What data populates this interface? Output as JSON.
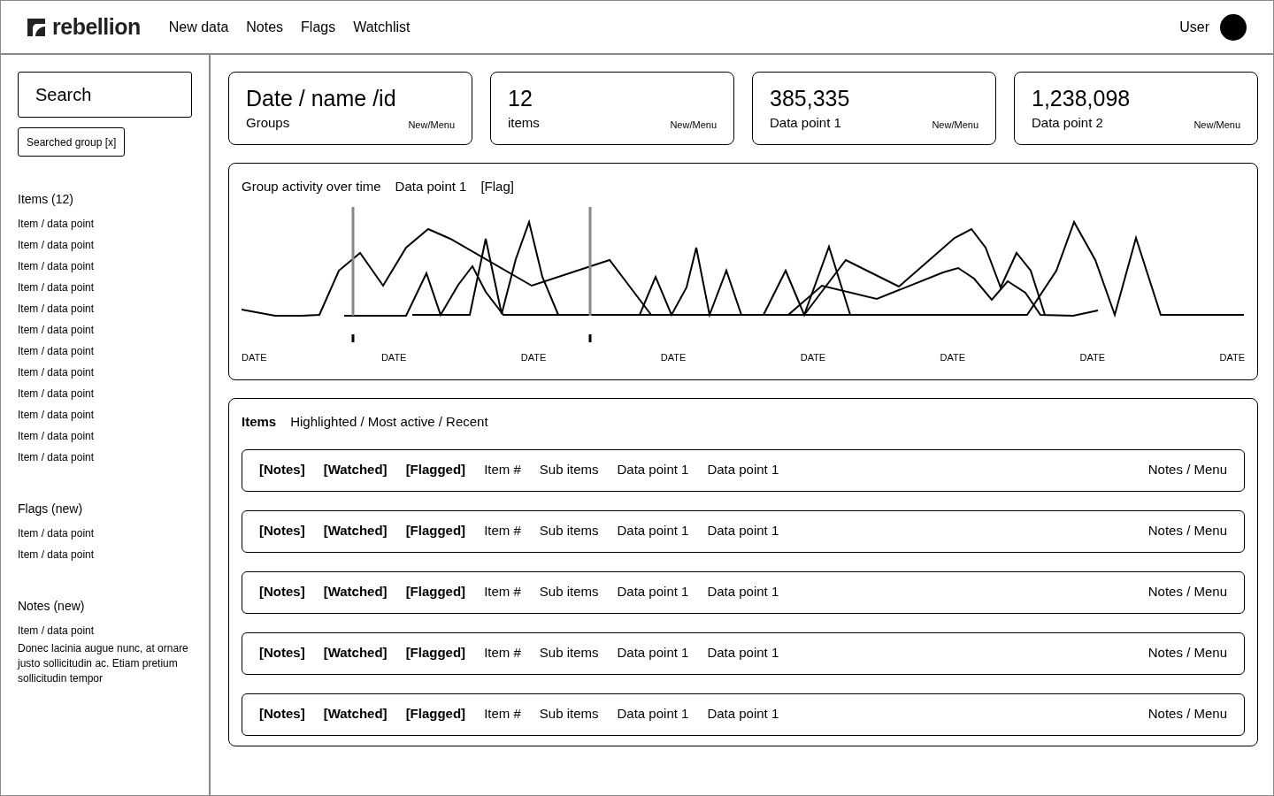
{
  "header": {
    "logo": "rebellion",
    "nav": [
      "New data",
      "Notes",
      "Flags",
      "Watchlist"
    ],
    "user": "User"
  },
  "sidebar": {
    "search": {
      "placeholder": "Search"
    },
    "chip": "Searched group [x]",
    "sections": [
      {
        "title": "Items (12)",
        "items": [
          "Item / data point",
          "Item / data point",
          "Item / data point",
          "Item / data point",
          "Item / data point",
          "Item / data point",
          "Item / data point",
          "Item / data point",
          "Item / data point",
          "Item / data point",
          "Item / data point",
          "Item / data point"
        ]
      },
      {
        "title": "Flags (new)",
        "items": [
          "Item / data point",
          "Item / data point"
        ]
      },
      {
        "title": "Notes (new)",
        "items": [
          "Item / data point"
        ],
        "note": "Donec lacinia augue nunc, at ornare justo sollicitudin ac. Etiam pretium sollicitudin tempor"
      }
    ]
  },
  "stats": [
    {
      "value": "Date / name /id",
      "label": "Groups",
      "action": "New/Menu"
    },
    {
      "value": "12",
      "label": "items",
      "action": "New/Menu"
    },
    {
      "value": "385,335",
      "label": "Data point 1",
      "action": "New/Menu"
    },
    {
      "value": "1,238,098",
      "label": "Data point 2",
      "action": "New/Menu"
    }
  ],
  "activity": {
    "title": "Group activity over time",
    "series_label": "Data point 1",
    "flag": "[Flag]",
    "x_labels": [
      "DATE",
      "DATE",
      "DATE",
      "DATE",
      "DATE",
      "DATE",
      "DATE",
      "DATE"
    ]
  },
  "items_panel": {
    "title": "Items",
    "filters": "Highlighted / Most active / Recent",
    "rows": [
      {
        "cells": [
          {
            "text": "[Notes]",
            "bold": true
          },
          {
            "text": "[Watched]",
            "bold": true
          },
          {
            "text": "[Flagged]",
            "bold": true
          },
          {
            "text": "Item #",
            "bold": false
          },
          {
            "text": "Sub items",
            "bold": false
          },
          {
            "text": "Data point 1",
            "bold": false
          },
          {
            "text": "Data point 1",
            "bold": false
          }
        ],
        "action": "Notes / Menu"
      },
      {
        "cells": [
          {
            "text": "[Notes]",
            "bold": true
          },
          {
            "text": "[Watched]",
            "bold": true
          },
          {
            "text": "[Flagged]",
            "bold": true
          },
          {
            "text": "Item #",
            "bold": false
          },
          {
            "text": "Sub items",
            "bold": false
          },
          {
            "text": "Data point 1",
            "bold": false
          },
          {
            "text": "Data point 1",
            "bold": false
          }
        ],
        "action": "Notes / Menu"
      },
      {
        "cells": [
          {
            "text": "[Notes]",
            "bold": true
          },
          {
            "text": "[Watched]",
            "bold": true
          },
          {
            "text": "[Flagged]",
            "bold": true
          },
          {
            "text": "Item #",
            "bold": false
          },
          {
            "text": "Sub items",
            "bold": false
          },
          {
            "text": "Data point 1",
            "bold": false
          },
          {
            "text": "Data point 1",
            "bold": false
          }
        ],
        "action": "Notes / Menu"
      },
      {
        "cells": [
          {
            "text": "[Notes]",
            "bold": true
          },
          {
            "text": "[Watched]",
            "bold": true
          },
          {
            "text": "[Flagged]",
            "bold": true
          },
          {
            "text": "Item #",
            "bold": false
          },
          {
            "text": "Sub items",
            "bold": false
          },
          {
            "text": "Data point 1",
            "bold": false
          },
          {
            "text": "Data point 1",
            "bold": false
          }
        ],
        "action": "Notes / Menu"
      },
      {
        "cells": [
          {
            "text": "[Notes]",
            "bold": true
          },
          {
            "text": "[Watched]",
            "bold": true
          },
          {
            "text": "[Flagged]",
            "bold": true
          },
          {
            "text": "Item #",
            "bold": false
          },
          {
            "text": "Sub items",
            "bold": false
          },
          {
            "text": "Data point 1",
            "bold": false
          },
          {
            "text": "Data point 1",
            "bold": false
          }
        ],
        "action": "Notes / Menu"
      }
    ]
  }
}
